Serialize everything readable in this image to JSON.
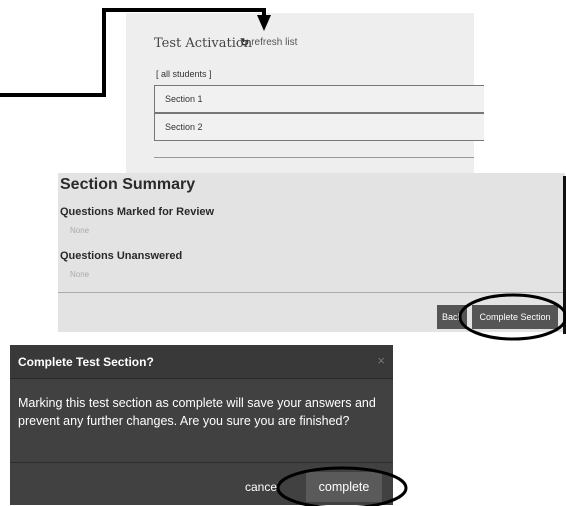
{
  "activation": {
    "title": "Test Activation",
    "refresh_icon": "refresh-icon",
    "refresh_label": "refresh list",
    "filter": "[ all students ]",
    "sections": [
      "Section 1",
      "Section 2"
    ]
  },
  "summary": {
    "title": "Section Summary",
    "marked_heading": "Questions Marked for Review",
    "marked_value": "None",
    "unanswered_heading": "Questions Unanswered",
    "unanswered_value": "None",
    "back_label": "Back",
    "complete_section_label": "Complete Section"
  },
  "dialog": {
    "title": "Complete Test Section?",
    "close_icon": "close-icon",
    "close_glyph": "×",
    "message": "Marking this test section as complete will save your answers and prevent any further changes. Are you sure you are finished?",
    "cancel_label": "cancel",
    "complete_label": "complete"
  },
  "colors": {
    "dialog_bg": "#414141",
    "panel_bg": "#e3e3e3",
    "button_bg": "#555555",
    "annotation": "#000000"
  }
}
